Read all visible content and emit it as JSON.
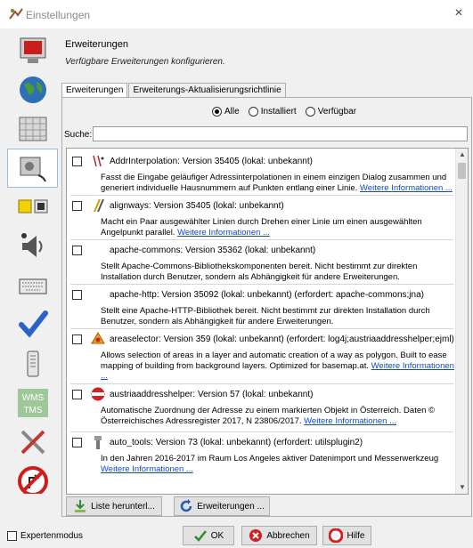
{
  "window": {
    "title": "Einstellungen",
    "close_glyph": "×",
    "icon": "josm-icon"
  },
  "sidebar": {
    "items": [
      {
        "name": "display-settings",
        "icon": "display-icon"
      },
      {
        "name": "map-settings",
        "icon": "globe-icon"
      },
      {
        "name": "map-paint-styles",
        "icon": "paint-icon"
      },
      {
        "name": "plugins",
        "icon": "plugin-icon",
        "selected": true
      },
      {
        "name": "connection",
        "icon": "connection-icon"
      },
      {
        "name": "audio",
        "icon": "speaker-icon"
      },
      {
        "name": "shortcuts",
        "icon": "keyboard-icon"
      },
      {
        "name": "validator",
        "icon": "checkmark-icon"
      },
      {
        "name": "remote-control",
        "icon": "remote-icon"
      },
      {
        "name": "imagery",
        "icon": "wms-tms-icon",
        "text1": "WMS",
        "text2": "TMS"
      },
      {
        "name": "advanced",
        "icon": "tools-icon"
      },
      {
        "name": "turn-restrictions",
        "icon": "no-turn-icon"
      }
    ]
  },
  "main": {
    "title": "Erweiterungen",
    "description": "Verfügbare Erweiterungen konfigurieren.",
    "tabs": [
      {
        "label": "Erweiterungen",
        "active": true
      },
      {
        "label": "Erweiterungs-Aktualisierungsrichtlinie",
        "active": false
      }
    ],
    "filters": [
      {
        "label": "Alle",
        "checked": true
      },
      {
        "label": "Installiert",
        "checked": false
      },
      {
        "label": "Verfügbar",
        "checked": false
      }
    ],
    "search": {
      "label": "Suche:",
      "value": ""
    },
    "plugins": [
      {
        "head": "AddrInterpolation: Version 35405 (lokal: unbekannt)",
        "icon": "addr-interpolation-icon",
        "desc": "Fasst die Eingabe geläufiger Adressinterpolationen in einem einzigen Dialog zusammen und generiert individuelle Hausnummern auf Punkten entlang einer Linie.",
        "link": "Weitere Informationen ..."
      },
      {
        "head": "alignways: Version 35405 (lokal: unbekannt)",
        "icon": "alignways-icon",
        "desc": "Macht ein Paar ausgewählter Linien durch Drehen einer Linie um einen ausgewählten Angelpunkt parallel.",
        "link": "Weitere Informationen ..."
      },
      {
        "head": "apache-commons: Version 35362 (lokal: unbekannt)",
        "icon": "",
        "desc": "Stellt Apache-Commons-Bibliothekskomponenten bereit. Nicht bestimmt zur direkten Installation durch Benutzer, sondern als Abhängigkeit für andere Erweiterungen.",
        "link": ""
      },
      {
        "head": "apache-http: Version 35092 (lokal: unbekannt) (erfordert: apache-commons;jna)",
        "icon": "",
        "desc": "Stellt eine Apache-HTTP-Bibliothek bereit. Nicht bestimmt zur direkten Installation durch Benutzer, sondern als Abhängigkeit für andere Erweiterungen.",
        "link": ""
      },
      {
        "head": "areaselector: Version 359 (lokal: unbekannt) (erfordert: log4j;austriaaddresshelper;ejml)",
        "icon": "areaselector-icon",
        "desc": "Allows selection of areas in a layer and automatic creation of a way as polygon. Built to ease mapping of building from background layers. Optimized for basemap.at.",
        "link": "Weitere Informationen ..."
      },
      {
        "head": "austriaaddresshelper: Version 57 (lokal: unbekannt)",
        "icon": "austria-icon",
        "desc": "Automatische Zuordnung der Adresse zu einem markierten Objekt in Österreich. Daten © Österreichisches Adressregister 2017, N 23806/2017.",
        "link": "Weitere Informationen ..."
      },
      {
        "head": "auto_tools: Version 73 (lokal: unbekannt) (erfordert: utilsplugin2)",
        "icon": "auto-tools-icon",
        "desc": "In den Jahren 2016-2017 im Raum Los Angeles aktiver Datenimport und Messerwerkzeug",
        "link": "Weitere Informationen ..."
      }
    ],
    "buttons": {
      "download_list": "Liste herunterl...",
      "update_plugins": "Erweiterungen ..."
    }
  },
  "footer": {
    "expert_mode": "Expertenmodus",
    "ok": "OK",
    "cancel": "Abbrechen",
    "help": "Hilfe"
  }
}
